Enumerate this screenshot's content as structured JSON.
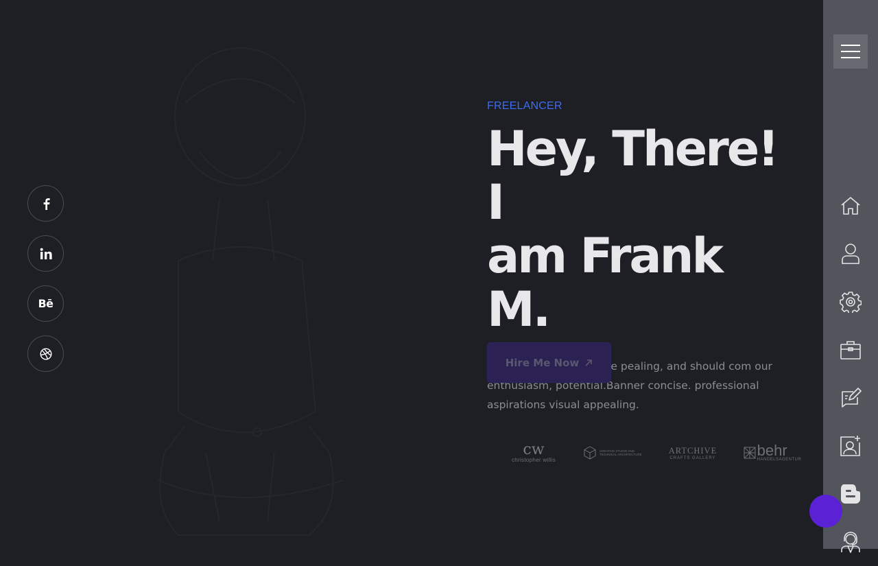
{
  "social": {
    "items": [
      {
        "name": "facebook",
        "icon": "facebook-icon"
      },
      {
        "name": "linkedin",
        "icon": "linkedin-icon",
        "label": "in"
      },
      {
        "name": "behance",
        "icon": "behance-icon",
        "label": "Bē"
      },
      {
        "name": "dribbble",
        "icon": "dribbble-icon"
      }
    ]
  },
  "hero": {
    "eyebrow": "FREELANCER",
    "title_line1": "Hey, There! I",
    "title_line2": "am Frank M.",
    "description": "Banner should b concise pealing, and should com our enthusiasm, potential.Banner concise. professional aspirations visual appealing.",
    "cta_label": "Hire Me Now"
  },
  "logos": {
    "cw_mark": "cw",
    "cw_name": "christopher willis",
    "cube_text": "CREATIVE STUDIO AND TECHNICAL ARCHITECTURE",
    "archive_title": "ARTCHIVE",
    "archive_sub": "CRAFTS GALLERY",
    "behr_word": "behr",
    "behr_sub": "HANDELSAGENTUR"
  },
  "sidebar": {
    "items": [
      "home-icon",
      "user-icon",
      "settings-icon",
      "briefcase-icon",
      "edit-icon",
      "contact-card-icon",
      "blog-icon",
      "support-icon"
    ]
  },
  "colors": {
    "background": "#1e1f25",
    "sidebar": "#53555d",
    "accent_blue": "#3f6bf0",
    "accent_purple": "#5b21d4"
  }
}
